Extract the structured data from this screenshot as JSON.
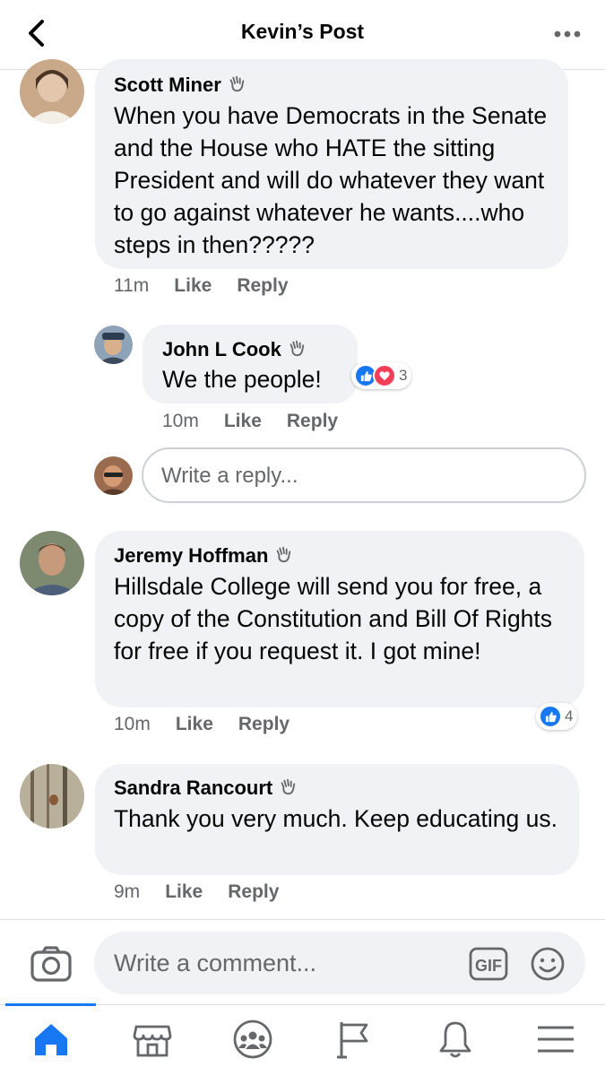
{
  "header": {
    "title": "Kevin’s Post"
  },
  "comments": [
    {
      "author": "Scott Miner",
      "text": "When you have Democrats in the Senate and the House who HATE the sitting President and will do whatever they want to go against whatever he wants....who steps in then?????",
      "time": "11m",
      "like": "Like",
      "reply": "Reply"
    },
    {
      "author": "John L Cook",
      "text": "We the people!",
      "time": "10m",
      "like": "Like",
      "reply": "Reply",
      "reactions": {
        "types": [
          "like",
          "love"
        ],
        "count": "3"
      }
    },
    {
      "author": "Jeremy Hoffman",
      "text": "Hillsdale College will send you for free, a copy of the Constitution and Bill Of Rights for free if you request it. I got mine!",
      "time": "10m",
      "like": "Like",
      "reply": "Reply",
      "reactions": {
        "types": [
          "like"
        ],
        "count": "4"
      }
    },
    {
      "author": "Sandra Rancourt",
      "text": "Thank you very much. Keep educating us.",
      "time": "9m",
      "like": "Like",
      "reply": "Reply"
    }
  ],
  "reply_box": {
    "placeholder": "Write a reply..."
  },
  "composer": {
    "placeholder": "Write a comment...",
    "gif": "GIF"
  },
  "tabs": [
    "home-icon",
    "marketplace-icon",
    "groups-icon",
    "pages-flag-icon",
    "notifications-bell-icon",
    "menu-icon"
  ],
  "colors": {
    "accent": "#1877f2",
    "bubble": "#f0f2f5",
    "secondary_text": "#65676b",
    "love": "#f33e58"
  }
}
